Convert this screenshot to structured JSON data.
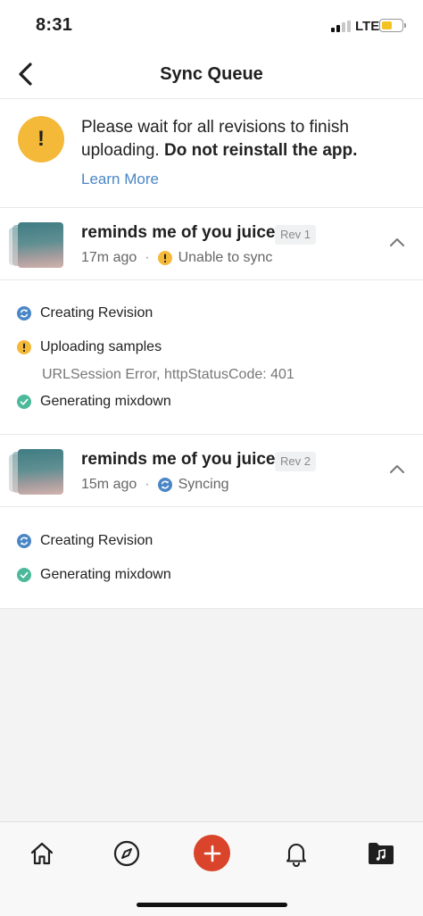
{
  "status_bar": {
    "time": "8:31",
    "network": "LTE"
  },
  "nav": {
    "title": "Sync Queue"
  },
  "notice": {
    "text": "Please wait for all revisions to finish uploading.",
    "bold_text": "Do not reinstall the app.",
    "link": "Learn More"
  },
  "revisions": [
    {
      "title": "reminds me of you juice",
      "badge": "Rev 1",
      "time": "17m ago",
      "separator": "·",
      "status": "Unable to sync",
      "status_icon": "warning-icon",
      "steps": [
        {
          "label": "Creating Revision",
          "icon": "sync-icon"
        },
        {
          "label": "Uploading samples",
          "icon": "warning-icon",
          "error": "URLSession Error, httpStatusCode: 401"
        },
        {
          "label": "Generating mixdown",
          "icon": "check-icon"
        }
      ]
    },
    {
      "title": "reminds me of you juice",
      "badge": "Rev 2",
      "time": "15m ago",
      "separator": "·",
      "status": "Syncing",
      "status_icon": "sync-icon",
      "steps": [
        {
          "label": "Creating Revision",
          "icon": "sync-icon"
        },
        {
          "label": "Generating mixdown",
          "icon": "check-icon"
        }
      ]
    }
  ],
  "tab_bar": {
    "items": [
      "home-icon",
      "compass-icon",
      "add-icon",
      "bell-icon",
      "library-icon"
    ]
  },
  "colors": {
    "accent_blue": "#4a86c6",
    "warning_yellow": "#f5b93a",
    "success_green": "#4cb99a",
    "add_red": "#d9442b"
  }
}
